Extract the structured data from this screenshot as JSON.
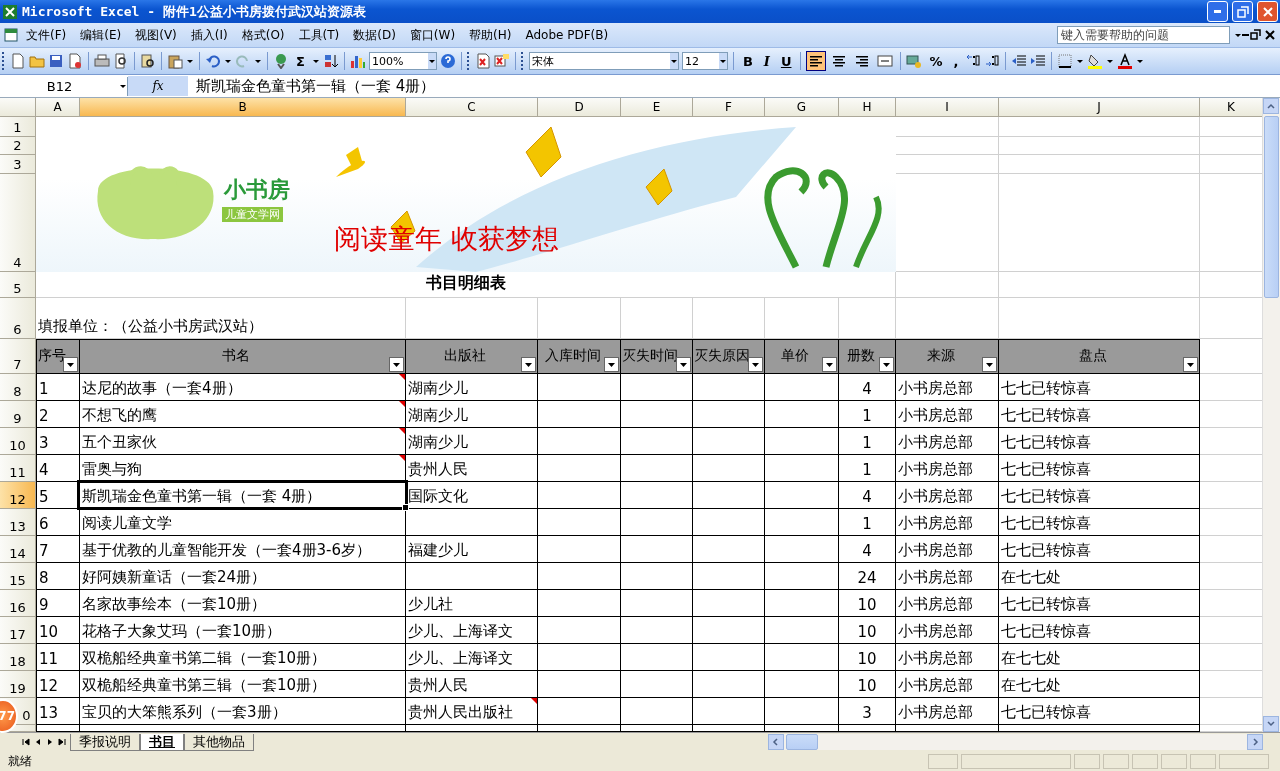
{
  "window": {
    "title": "Microsoft Excel - 附件1公益小书房拨付武汉站资源表"
  },
  "menu": [
    "文件(F)",
    "编辑(E)",
    "视图(V)",
    "插入(I)",
    "格式(O)",
    "工具(T)",
    "数据(D)",
    "窗口(W)",
    "帮助(H)",
    "Adobe PDF(B)"
  ],
  "help_box": {
    "placeholder": "键入需要帮助的问题"
  },
  "toolbar": {
    "autosum": "Σ",
    "zoom": "100%",
    "font": "宋体",
    "font_size": "12",
    "format_buttons": [
      "B",
      "I",
      "U"
    ],
    "alignment": [
      {
        "selected": true
      },
      {
        "selected": false
      },
      {
        "selected": false
      },
      {
        "selected": false
      }
    ],
    "number_buttons": [
      "%",
      ","
    ]
  },
  "formula_bar": {
    "name_box": "B12",
    "fx": "fx",
    "content": "斯凯瑞金色童书第一辑（一套 4册）"
  },
  "columns": [
    {
      "label": "A",
      "selected": false
    },
    {
      "label": "B",
      "selected": true
    },
    {
      "label": "C",
      "selected": false
    },
    {
      "label": "D",
      "selected": false
    },
    {
      "label": "E",
      "selected": false
    },
    {
      "label": "F",
      "selected": false
    },
    {
      "label": "G",
      "selected": false
    },
    {
      "label": "H",
      "selected": false
    },
    {
      "label": "I",
      "selected": false
    },
    {
      "label": "J",
      "selected": false
    },
    {
      "label": "K",
      "selected": false
    }
  ],
  "row_headers": [
    {
      "label": "1",
      "selected": false
    },
    {
      "label": "2",
      "selected": false
    },
    {
      "label": "3",
      "selected": false
    },
    {
      "label": "4",
      "selected": false
    },
    {
      "label": "5",
      "selected": false
    },
    {
      "label": "6",
      "selected": false
    },
    {
      "label": "7",
      "selected": false
    },
    {
      "label": "8",
      "selected": false
    },
    {
      "label": "9",
      "selected": false
    },
    {
      "label": "10",
      "selected": false
    },
    {
      "label": "11",
      "selected": false
    },
    {
      "label": "12",
      "selected": true
    },
    {
      "label": "13",
      "selected": false
    },
    {
      "label": "14",
      "selected": false
    },
    {
      "label": "15",
      "selected": false
    },
    {
      "label": "16",
      "selected": false
    },
    {
      "label": "17",
      "selected": false
    },
    {
      "label": "18",
      "selected": false
    },
    {
      "label": "19",
      "selected": false
    },
    {
      "label": "0",
      "selected": false
    }
  ],
  "banner": {
    "logo": "小书房",
    "logo_sub": "儿童文学网",
    "slogan": "阅读童年 收获梦想"
  },
  "sheet_title": "书目明细表",
  "unit": "填报单位：（公益小书房武汉站）",
  "table": {
    "headers": [
      "序号",
      "书名",
      "出版社",
      "入库时间",
      "灭失时间",
      "灭失原因",
      "单价",
      "册数",
      "来源",
      "盘点"
    ],
    "rows": [
      {
        "no": "1",
        "title": "达尼的故事（一套4册）",
        "publisher": "湖南少儿",
        "count": "4",
        "source": "小书房总部",
        "status": "七七已转惊喜",
        "title_comment": true,
        "publisher_comment": false,
        "active": false
      },
      {
        "no": "2",
        "title": "不想飞的鹰",
        "publisher": "湖南少儿",
        "count": "1",
        "source": "小书房总部",
        "status": "七七已转惊喜",
        "title_comment": true,
        "publisher_comment": false,
        "active": false
      },
      {
        "no": "3",
        "title": "五个丑家伙",
        "publisher": "湖南少儿",
        "count": "1",
        "source": "小书房总部",
        "status": "七七已转惊喜",
        "title_comment": true,
        "publisher_comment": false,
        "active": false
      },
      {
        "no": "4",
        "title": "雷奥与狗",
        "publisher": "贵州人民",
        "count": "1",
        "source": "小书房总部",
        "status": "七七已转惊喜",
        "title_comment": true,
        "publisher_comment": false,
        "active": false
      },
      {
        "no": "5",
        "title": "斯凯瑞金色童书第一辑（一套 4册）",
        "publisher": "国际文化",
        "count": "4",
        "source": "小书房总部",
        "status": "七七已转惊喜",
        "title_comment": false,
        "publisher_comment": false,
        "active": true
      },
      {
        "no": "6",
        "title": "阅读儿童文学",
        "count": "1",
        "source": "小书房总部",
        "status": "七七已转惊喜",
        "title_comment": false,
        "publisher_comment": false,
        "active": false
      },
      {
        "no": "7",
        "title": "基于优教的儿童智能开发（一套4册3-6岁）",
        "publisher": "福建少儿",
        "count": "4",
        "source": "小书房总部",
        "status": "七七已转惊喜",
        "title_comment": false,
        "publisher_comment": false,
        "active": false
      },
      {
        "no": "8",
        "title": "好阿姨新童话（一套24册）",
        "count": "24",
        "source": "小书房总部",
        "status": "在七七处",
        "title_comment": false,
        "publisher_comment": false,
        "active": false
      },
      {
        "no": "9",
        "title": "名家故事绘本（一套10册）",
        "publisher": "少儿社",
        "count": "10",
        "source": "小书房总部",
        "status": "七七已转惊喜",
        "title_comment": false,
        "publisher_comment": false,
        "active": false
      },
      {
        "no": "10",
        "title": "花格子大象艾玛（一套10册）",
        "publisher": "少儿、上海译文",
        "count": "10",
        "source": "小书房总部",
        "status": "七七已转惊喜",
        "title_comment": false,
        "publisher_comment": false,
        "active": false
      },
      {
        "no": "11",
        "title": "双桅船经典童书第二辑（一套10册）",
        "publisher": "少儿、上海译文",
        "count": "10",
        "source": "小书房总部",
        "status": "在七七处",
        "title_comment": false,
        "publisher_comment": false,
        "active": false
      },
      {
        "no": "12",
        "title": "双桅船经典童书第三辑（一套10册）",
        "publisher": "贵州人民",
        "count": "10",
        "source": "小书房总部",
        "status": "在七七处",
        "title_comment": false,
        "publisher_comment": false,
        "active": false
      },
      {
        "no": "13",
        "title": "宝贝的大笨熊系列（一套3册）",
        "publisher": "贵州人民出版社",
        "count": "3",
        "source": "小书房总部",
        "status": "七七已转惊喜",
        "title_comment": false,
        "publisher_comment": true,
        "active": false
      }
    ]
  },
  "sheet_tabs": [
    {
      "label": "季报说明",
      "selected": false
    },
    {
      "label": "书目",
      "selected": true
    },
    {
      "label": "其他物品",
      "selected": false
    }
  ],
  "status_bar": {
    "text": "就绪"
  },
  "floating_badge": "77"
}
